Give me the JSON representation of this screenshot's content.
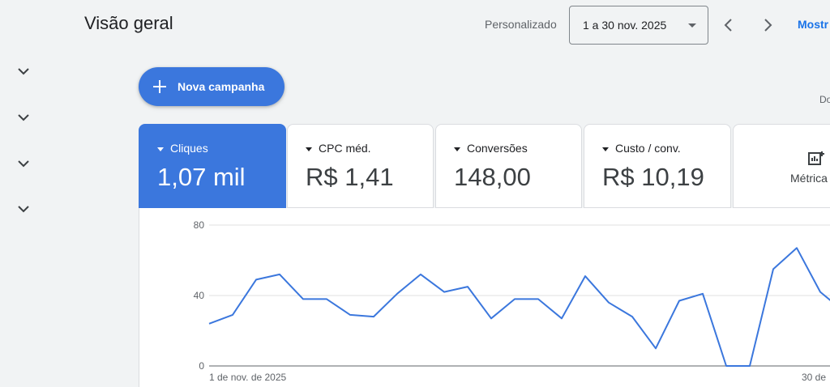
{
  "header": {
    "title": "Visão geral",
    "range_label": "Personalizado",
    "date_range": "1 a 30 nov. 2025",
    "show_link": "Mostr"
  },
  "actions": {
    "new_campaign": "Nova campanha",
    "cut_text": "Do"
  },
  "metrics": [
    {
      "name": "Cliques",
      "value": "1,07 mil",
      "active": true
    },
    {
      "name": "CPC méd.",
      "value": "R$ 1,41",
      "active": false
    },
    {
      "name": "Conversões",
      "value": "148,00",
      "active": false
    },
    {
      "name": "Custo / conv.",
      "value": "R$ 10,19",
      "active": false
    }
  ],
  "metrics_button": "Métrica",
  "icons": [
    "chevron-left-icon",
    "chevron-right-icon",
    "chevron-down-icon",
    "plus-icon",
    "metrics-chart-icon"
  ],
  "colors": {
    "accent": "#3b77dd",
    "link": "#1a73e8",
    "line": "#3b77dd"
  },
  "chart_data": {
    "type": "line",
    "ylim": [
      0,
      80
    ],
    "yticks": [
      "0",
      "40",
      "80"
    ],
    "x_start_label": "1 de nov. de 2025",
    "x_end_label": "30 de",
    "series": [
      {
        "values": [
          24,
          29,
          49,
          52,
          38,
          38,
          29,
          28,
          41,
          52,
          42,
          45,
          27,
          38,
          38,
          27,
          51,
          36,
          28,
          10,
          37,
          41,
          0,
          0,
          55,
          67,
          42,
          31
        ]
      }
    ]
  }
}
